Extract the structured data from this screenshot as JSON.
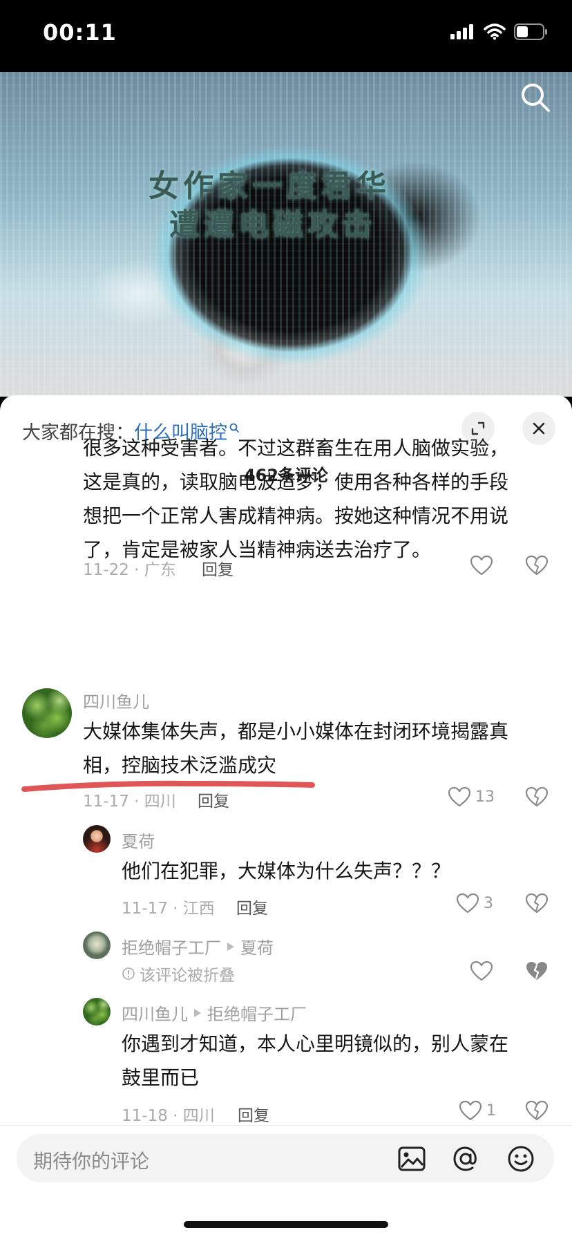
{
  "status": {
    "time": "00:11"
  },
  "video": {
    "caption_line1": "女作家一度君华",
    "caption_line2": "遭遭电磁攻击"
  },
  "sheet": {
    "search_prefix": "大家都在搜：",
    "search_keyword": "什么叫脑控",
    "count": "462条评论"
  },
  "comments": [
    {
      "text_lines": [
        "很多这种受害者。不过这群畜生在用人脑做实验，",
        "这是真的，读取脑电波造梦，使用各种各样的手段",
        "想把一个正常人害成精神病。按她这种情况不用说",
        "了，肯定是被家人当精神病送去治疗了。"
      ],
      "meta": "11-22 · 广东",
      "reply": "回复"
    },
    {
      "user": "四川鱼儿",
      "text_lines": [
        "大媒体集体失声，都是小小媒体在封闭环境揭露真",
        "相，控脑技术泛滥成灾"
      ],
      "meta": "11-17 · 四川",
      "reply": "回复",
      "likes": "13"
    },
    {
      "user": "夏荷",
      "text": "他们在犯罪，大媒体为什么失声？？？",
      "meta": "11-17 · 江西",
      "reply": "回复",
      "likes": "3"
    },
    {
      "user": "拒绝帽子工厂",
      "reply_to": "夏荷",
      "folded": "该评论被折叠"
    },
    {
      "user": "四川鱼儿",
      "reply_to": "拒绝帽子工厂",
      "text_lines": [
        "你遇到才知道，本人心里明镜似的，别人蒙在",
        "鼓里而已"
      ],
      "meta": "11-18 · 四川",
      "reply": "回复",
      "likes": "1"
    }
  ],
  "input": {
    "placeholder": "期待你的评论"
  },
  "icons": [
    "signal-icon",
    "wifi-icon",
    "battery-icon",
    "search-icon",
    "expand-icon",
    "close-icon",
    "heart-icon",
    "broken-heart-icon",
    "image-icon",
    "at-icon",
    "emoji-icon"
  ],
  "colors": {
    "keyword": "#2d6fb8",
    "annotation": "#e05555"
  }
}
